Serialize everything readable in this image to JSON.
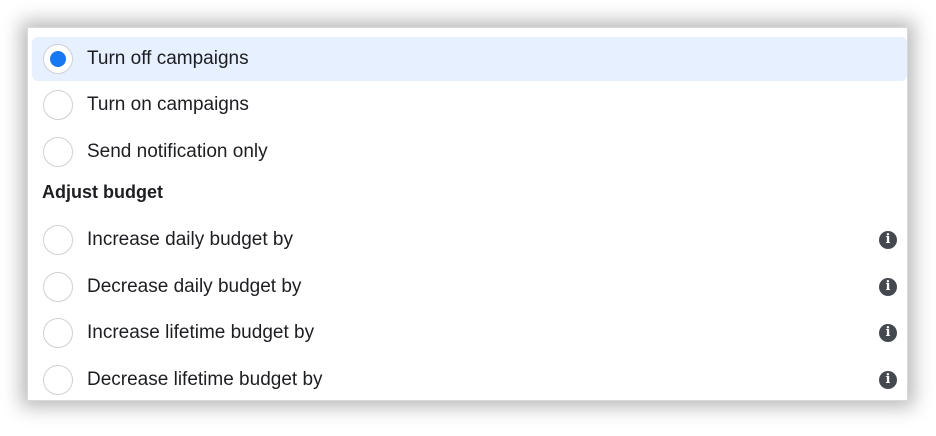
{
  "actions": [
    {
      "label": "Turn off campaigns",
      "selected": true
    },
    {
      "label": "Turn on campaigns",
      "selected": false
    },
    {
      "label": "Send notification only",
      "selected": false
    }
  ],
  "budget_section": {
    "heading": "Adjust budget",
    "options": [
      {
        "label": "Increase daily budget by",
        "info_icon": "info-icon"
      },
      {
        "label": "Decrease daily budget by",
        "info_icon": "info-icon"
      },
      {
        "label": "Increase lifetime budget by",
        "info_icon": "info-icon"
      },
      {
        "label": "Decrease lifetime budget by",
        "info_icon": "info-icon"
      }
    ]
  },
  "colors": {
    "selected_row_bg": "#e7f0fe",
    "radio_selected": "#1877f2",
    "info_icon": "#444950"
  }
}
